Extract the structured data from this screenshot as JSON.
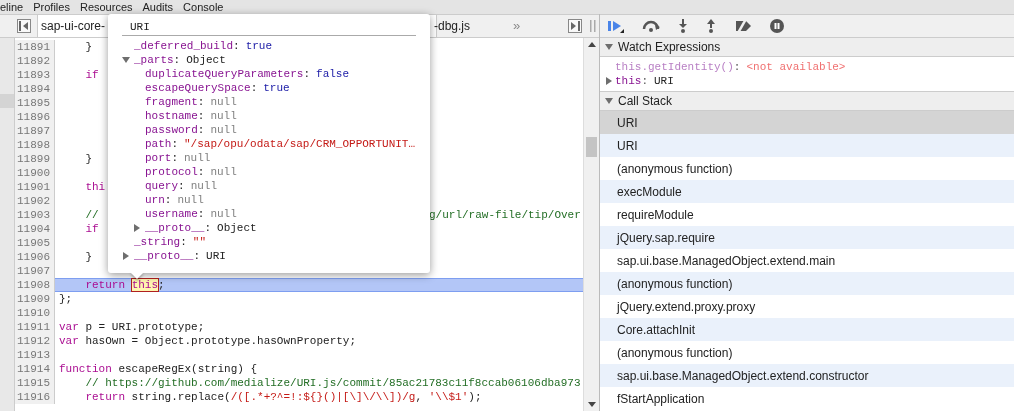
{
  "menu": [
    {
      "label": "eline"
    },
    {
      "label": "Profiles"
    },
    {
      "label": "Resources"
    },
    {
      "label": "Audits"
    },
    {
      "label": "Console"
    }
  ],
  "file_tab": {
    "label_left": "sap-ui-core-",
    "label_right": "-dbg.js",
    "overflow": "»"
  },
  "code": {
    "lines": [
      {
        "number": "11891",
        "selected": false,
        "tokens": [
          {
            "kind": "plain",
            "text": "    }"
          }
        ]
      },
      {
        "number": "11892",
        "selected": false
      },
      {
        "number": "11893",
        "selected": false,
        "tokens": [
          {
            "kind": "keyword",
            "text": "    if"
          }
        ]
      },
      {
        "number": "11894",
        "selected": false
      },
      {
        "number": "11895",
        "selected": false
      },
      {
        "number": "11896",
        "selected": false
      },
      {
        "number": "11897",
        "selected": false
      },
      {
        "number": "11898",
        "selected": false
      },
      {
        "number": "11899",
        "selected": false,
        "tokens": [
          {
            "kind": "plain",
            "text": "    }"
          }
        ]
      },
      {
        "number": "11900",
        "selected": false
      },
      {
        "number": "11901",
        "selected": false,
        "tokens": [
          {
            "kind": "keyword",
            "text": "    thi"
          }
        ]
      },
      {
        "number": "11902",
        "selected": false
      },
      {
        "number": "11903",
        "selected": false,
        "tokens": [
          {
            "kind": "comment",
            "text": "    //"
          }
        ],
        "right": [
          {
            "kind": "comment",
            "text": "g/url/raw-file/tip/Over"
          }
        ]
      },
      {
        "number": "11904",
        "selected": false,
        "tokens": [
          {
            "kind": "keyword",
            "text": "    if"
          }
        ]
      },
      {
        "number": "11905",
        "selected": false
      },
      {
        "number": "11906",
        "selected": false,
        "tokens": [
          {
            "kind": "plain",
            "text": "    }"
          }
        ]
      },
      {
        "number": "11907",
        "selected": false
      },
      {
        "number": "11908",
        "selected": true,
        "tokens": [
          {
            "kind": "keyword",
            "text": "    return "
          },
          {
            "kind": "match",
            "text": "this"
          },
          {
            "kind": "plain",
            "text": ";"
          }
        ]
      },
      {
        "number": "11909",
        "selected": false,
        "tokens": [
          {
            "kind": "plain",
            "text": "};"
          }
        ]
      },
      {
        "number": "11910",
        "selected": false
      },
      {
        "number": "11911",
        "selected": false,
        "tokens": [
          {
            "kind": "keyword",
            "text": "var"
          },
          {
            "kind": "plain",
            "text": " p = URI.prototype;"
          }
        ]
      },
      {
        "number": "11912",
        "selected": false,
        "tokens": [
          {
            "kind": "keyword",
            "text": "var"
          },
          {
            "kind": "plain",
            "text": " hasOwn = Object.prototype.hasOwnProperty;"
          }
        ]
      },
      {
        "number": "11913",
        "selected": false
      },
      {
        "number": "11914",
        "selected": false,
        "tokens": [
          {
            "kind": "keyword",
            "text": "function"
          },
          {
            "kind": "plain",
            "text": " escapeRegEx(string) {"
          }
        ]
      },
      {
        "number": "11915",
        "selected": false,
        "tokens": [
          {
            "kind": "comment",
            "text": "    // https://github.com/medialize/URI.js/commit/85ac21783c11f8ccab06106dba973"
          }
        ]
      },
      {
        "number": "11916",
        "selected": false,
        "tokens": [
          {
            "kind": "keyword",
            "text": "    return"
          },
          {
            "kind": "plain",
            "text": " string.replace("
          },
          {
            "kind": "string",
            "text": "/([.*+?^=!:${}()|[\\]\\/\\\\])/g"
          },
          {
            "kind": "plain",
            "text": ", "
          },
          {
            "kind": "string",
            "text": "'\\\\$1'"
          },
          {
            "kind": "plain",
            "text": ");"
          }
        ]
      }
    ]
  },
  "popover": {
    "title": "URI",
    "nodes": [
      {
        "key": "_deferred_build",
        "separator": ":",
        "value": "true",
        "kind": "boolean"
      },
      {
        "key": "_parts",
        "separator": ":",
        "value": "Object",
        "kind": "object",
        "expanded": true,
        "children": [
          {
            "key": "duplicateQueryParameters",
            "separator": ":",
            "value": "false",
            "kind": "boolean"
          },
          {
            "key": "escapeQuerySpace",
            "separator": ":",
            "value": "true",
            "kind": "boolean"
          },
          {
            "key": "fragment",
            "separator": ":",
            "value": "null",
            "kind": "null"
          },
          {
            "key": "hostname",
            "separator": ":",
            "value": "null",
            "kind": "null"
          },
          {
            "key": "password",
            "separator": ":",
            "value": "null",
            "kind": "null"
          },
          {
            "key": "path",
            "separator": ":",
            "value": "\"/sap/opu/odata/sap/CRM_OPPORTUNIT…",
            "kind": "string"
          },
          {
            "key": "port",
            "separator": ":",
            "value": "null",
            "kind": "null"
          },
          {
            "key": "protocol",
            "separator": ":",
            "value": "null",
            "kind": "null"
          },
          {
            "key": "query",
            "separator": ":",
            "value": "null",
            "kind": "null"
          },
          {
            "key": "urn",
            "separator": ":",
            "value": "null",
            "kind": "null"
          },
          {
            "key": "username",
            "separator": ":",
            "value": "null",
            "kind": "null"
          },
          {
            "key": "__proto__",
            "separator": ":",
            "value": "Object",
            "kind": "object",
            "expanded": false
          }
        ]
      },
      {
        "key": "_string",
        "separator": ":",
        "value": "\"\"",
        "kind": "string"
      },
      {
        "key": "__proto__",
        "separator": ":",
        "value": "URI",
        "kind": "object",
        "expanded": false
      }
    ]
  },
  "watch": {
    "title": "Watch Expressions",
    "expanded": true,
    "items": [
      {
        "expression": "this.getIdentity()",
        "separator": ":",
        "value": "<not available>",
        "expandable": false
      },
      {
        "expression": "this",
        "separator": ":",
        "value": "URI",
        "expandable": true,
        "expanded": false
      }
    ]
  },
  "call_stack": {
    "title": "Call Stack",
    "expanded": true,
    "frames": [
      {
        "label": "URI",
        "selected": true
      },
      {
        "label": "URI",
        "selected": false
      },
      {
        "label": "(anonymous function)",
        "selected": false
      },
      {
        "label": "execModule",
        "selected": false
      },
      {
        "label": "requireModule",
        "selected": false
      },
      {
        "label": "jQuery.sap.require",
        "selected": false
      },
      {
        "label": "sap.ui.base.ManagedObject.extend.main",
        "selected": false
      },
      {
        "label": "(anonymous function)",
        "selected": false
      },
      {
        "label": "jQuery.extend.proxy.proxy",
        "selected": false
      },
      {
        "label": "Core.attachInit",
        "selected": false
      },
      {
        "label": "(anonymous function)",
        "selected": false
      },
      {
        "label": "sap.ui.base.ManagedObject.extend.constructor",
        "selected": false
      },
      {
        "label": "fStartApplication",
        "selected": false
      }
    ]
  }
}
